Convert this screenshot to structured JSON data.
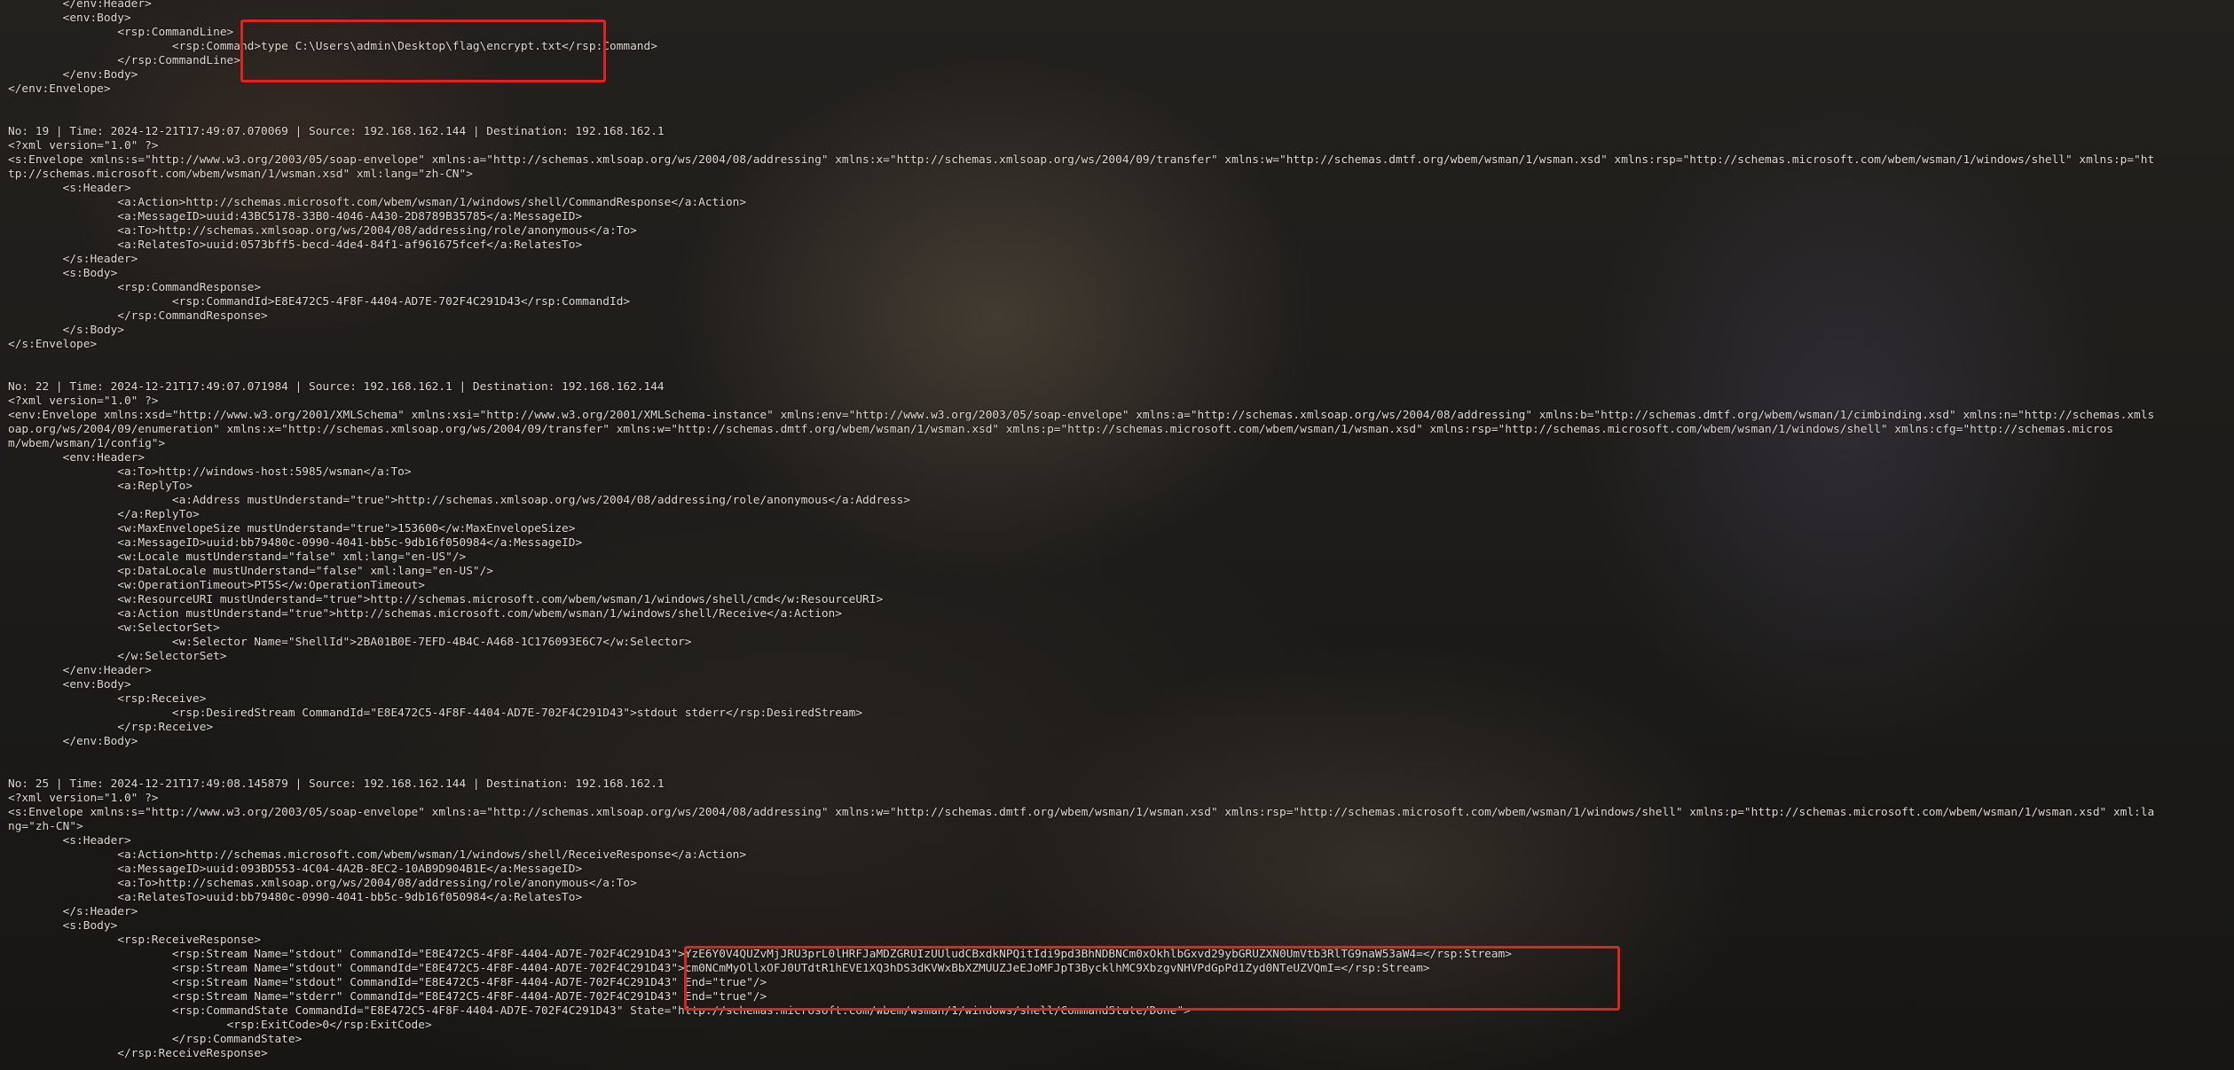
{
  "terminal": {
    "lines": [
      "        </env:Header>",
      "        <env:Body>",
      "                <rsp:CommandLine>",
      "                        <rsp:Command>type C:\\Users\\admin\\Desktop\\flag\\encrypt.txt</rsp:Command>",
      "                </rsp:CommandLine>",
      "        </env:Body>",
      "</env:Envelope>",
      "",
      "",
      "No: 19 | Time: 2024-12-21T17:49:07.070069 | Source: 192.168.162.144 | Destination: 192.168.162.1",
      "<?xml version=\"1.0\" ?>",
      "<s:Envelope xmlns:s=\"http://www.w3.org/2003/05/soap-envelope\" xmlns:a=\"http://schemas.xmlsoap.org/ws/2004/08/addressing\" xmlns:x=\"http://schemas.xmlsoap.org/ws/2004/09/transfer\" xmlns:w=\"http://schemas.dmtf.org/wbem/wsman/1/wsman.xsd\" xmlns:rsp=\"http://schemas.microsoft.com/wbem/wsman/1/windows/shell\" xmlns:p=\"ht",
      "tp://schemas.microsoft.com/wbem/wsman/1/wsman.xsd\" xml:lang=\"zh-CN\">",
      "        <s:Header>",
      "                <a:Action>http://schemas.microsoft.com/wbem/wsman/1/windows/shell/CommandResponse</a:Action>",
      "                <a:MessageID>uuid:43BC5178-33B0-4046-A430-2D8789B35785</a:MessageID>",
      "                <a:To>http://schemas.xmlsoap.org/ws/2004/08/addressing/role/anonymous</a:To>",
      "                <a:RelatesTo>uuid:0573bff5-becd-4de4-84f1-af961675fcef</a:RelatesTo>",
      "        </s:Header>",
      "        <s:Body>",
      "                <rsp:CommandResponse>",
      "                        <rsp:CommandId>E8E472C5-4F8F-4404-AD7E-702F4C291D43</rsp:CommandId>",
      "                </rsp:CommandResponse>",
      "        </s:Body>",
      "</s:Envelope>",
      "",
      "",
      "No: 22 | Time: 2024-12-21T17:49:07.071984 | Source: 192.168.162.1 | Destination: 192.168.162.144",
      "<?xml version=\"1.0\" ?>",
      "<env:Envelope xmlns:xsd=\"http://www.w3.org/2001/XMLSchema\" xmlns:xsi=\"http://www.w3.org/2001/XMLSchema-instance\" xmlns:env=\"http://www.w3.org/2003/05/soap-envelope\" xmlns:a=\"http://schemas.xmlsoap.org/ws/2004/08/addressing\" xmlns:b=\"http://schemas.dmtf.org/wbem/wsman/1/cimbinding.xsd\" xmlns:n=\"http://schemas.xmls",
      "oap.org/ws/2004/09/enumeration\" xmlns:x=\"http://schemas.xmlsoap.org/ws/2004/09/transfer\" xmlns:w=\"http://schemas.dmtf.org/wbem/wsman/1/wsman.xsd\" xmlns:p=\"http://schemas.microsoft.com/wbem/wsman/1/wsman.xsd\" xmlns:rsp=\"http://schemas.microsoft.com/wbem/wsman/1/windows/shell\" xmlns:cfg=\"http://schemas.micros",
      "m/wbem/wsman/1/config\">",
      "        <env:Header>",
      "                <a:To>http://windows-host:5985/wsman</a:To>",
      "                <a:ReplyTo>",
      "                        <a:Address mustUnderstand=\"true\">http://schemas.xmlsoap.org/ws/2004/08/addressing/role/anonymous</a:Address>",
      "                </a:ReplyTo>",
      "                <w:MaxEnvelopeSize mustUnderstand=\"true\">153600</w:MaxEnvelopeSize>",
      "                <a:MessageID>uuid:bb79480c-0990-4041-bb5c-9db16f050984</a:MessageID>",
      "                <w:Locale mustUnderstand=\"false\" xml:lang=\"en-US\"/>",
      "                <p:DataLocale mustUnderstand=\"false\" xml:lang=\"en-US\"/>",
      "                <w:OperationTimeout>PT5S</w:OperationTimeout>",
      "                <w:ResourceURI mustUnderstand=\"true\">http://schemas.microsoft.com/wbem/wsman/1/windows/shell/cmd</w:ResourceURI>",
      "                <a:Action mustUnderstand=\"true\">http://schemas.microsoft.com/wbem/wsman/1/windows/shell/Receive</a:Action>",
      "                <w:SelectorSet>",
      "                        <w:Selector Name=\"ShellId\">2BA01B0E-7EFD-4B4C-A468-1C176093E6C7</w:Selector>",
      "                </w:SelectorSet>",
      "        </env:Header>",
      "        <env:Body>",
      "                <rsp:Receive>",
      "                        <rsp:DesiredStream CommandId=\"E8E472C5-4F8F-4404-AD7E-702F4C291D43\">stdout stderr</rsp:DesiredStream>",
      "                </rsp:Receive>",
      "        </env:Body>",
      "",
      "",
      "No: 25 | Time: 2024-12-21T17:49:08.145879 | Source: 192.168.162.144 | Destination: 192.168.162.1",
      "<?xml version=\"1.0\" ?>",
      "<s:Envelope xmlns:s=\"http://www.w3.org/2003/05/soap-envelope\" xmlns:a=\"http://schemas.xmlsoap.org/ws/2004/08/addressing\" xmlns:w=\"http://schemas.dmtf.org/wbem/wsman/1/wsman.xsd\" xmlns:rsp=\"http://schemas.microsoft.com/wbem/wsman/1/windows/shell\" xmlns:p=\"http://schemas.microsoft.com/wbem/wsman/1/wsman.xsd\" xml:la",
      "ng=\"zh-CN\">",
      "        <s:Header>",
      "                <a:Action>http://schemas.microsoft.com/wbem/wsman/1/windows/shell/ReceiveResponse</a:Action>",
      "                <a:MessageID>uuid:093BD553-4C04-4A2B-8EC2-10AB9D904B1E</a:MessageID>",
      "                <a:To>http://schemas.xmlsoap.org/ws/2004/08/addressing/role/anonymous</a:To>",
      "                <a:RelatesTo>uuid:bb79480c-0990-4041-bb5c-9db16f050984</a:RelatesTo>",
      "        </s:Header>",
      "        <s:Body>",
      "                <rsp:ReceiveResponse>",
      "                        <rsp:Stream Name=\"stdout\" CommandId=\"E8E472C5-4F8F-4404-AD7E-702F4C291D43\">YzE6Y0V4QUZvMjJRU3prL0lHRFJaMDZGRUIzUUludCBxdkNPQitIdi9pd3BhNDBNCm0xOkhlbGxvd29ybGRUZXN0UmVtb3RlTG9naW53aW4=</rsp:Stream>",
      "                        <rsp:Stream Name=\"stdout\" CommandId=\"E8E472C5-4F8F-4404-AD7E-702F4C291D43\">cm0NCmMyOllxOFJ0UTdtR1hEVE1XQ3hDS3dKVWxBbXZMUUZJeEJoMFJpT3BycklhMC9XbzgvNHVPdGpPd1Zyd0NTeUZVQmI=</rsp:Stream>",
      "                        <rsp:Stream Name=\"stdout\" CommandId=\"E8E472C5-4F8F-4404-AD7E-702F4C291D43\" End=\"true\"/>",
      "                        <rsp:Stream Name=\"stderr\" CommandId=\"E8E472C5-4F8F-4404-AD7E-702F4C291D43\" End=\"true\"/>",
      "                        <rsp:CommandState CommandId=\"E8E472C5-4F8F-4404-AD7E-702F4C291D43\" State=\"http://schemas.microsoft.com/wbem/wsman/1/windows/shell/CommandState/Done\">",
      "                                <rsp:ExitCode>0</rsp:ExitCode>",
      "                        </rsp:CommandState>",
      "                </rsp:ReceiveResponse>"
    ]
  },
  "colors": {
    "text": "#dedad2",
    "highlight": "#e0241c",
    "background": "#1b1a18"
  }
}
